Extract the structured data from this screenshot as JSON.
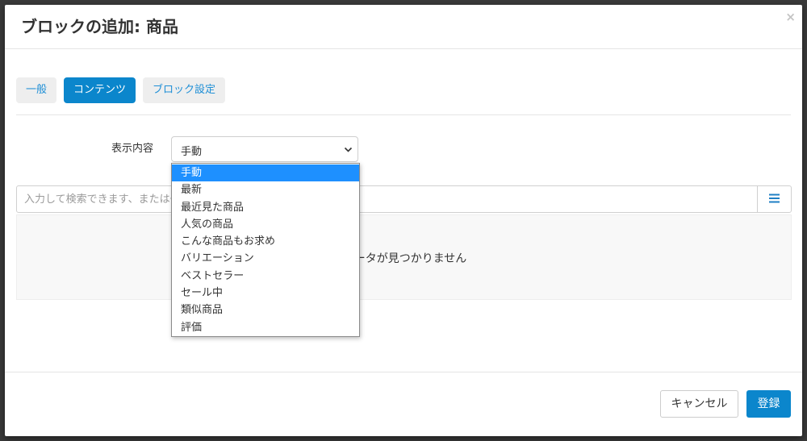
{
  "modal": {
    "title": "ブロックの追加: 商品",
    "close_label": "×"
  },
  "tabs": [
    {
      "label": "一般",
      "active": false
    },
    {
      "label": "コンテンツ",
      "active": true
    },
    {
      "label": "ブロック設定",
      "active": false
    }
  ],
  "display_content": {
    "label": "表示内容",
    "selected": "手動",
    "options": [
      "手動",
      "最新",
      "最近見た商品",
      "人気の商品",
      "こんな商品もお求め",
      "バリエーション",
      "ベストセラー",
      "セール中",
      "類似商品",
      "評価"
    ]
  },
  "search": {
    "placeholder": "入力して検索できます、または一覧から選択することもできます"
  },
  "empty_state": {
    "message": "データが見つかりません"
  },
  "footer": {
    "cancel_label": "キャンセル",
    "submit_label": "登録"
  },
  "colors": {
    "accent": "#0b86cc",
    "dropdown_highlight": "#1e90ff",
    "tab_inactive_bg": "#eeeeee",
    "backdrop": "#3a3a3a"
  },
  "icons": {
    "close": "close-icon",
    "select": "chevron-down-icon",
    "list": "list-icon"
  }
}
